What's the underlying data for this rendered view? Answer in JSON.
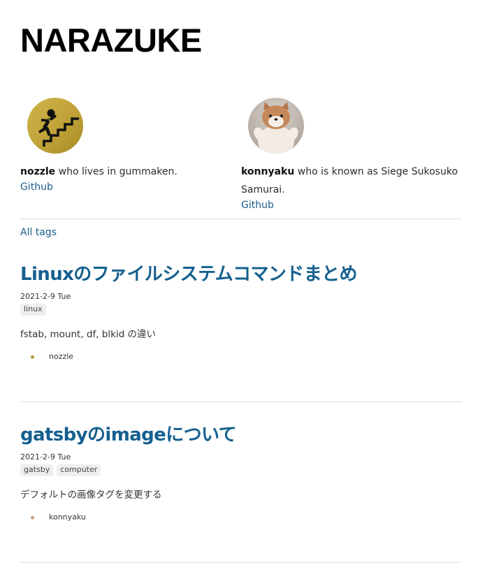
{
  "site": {
    "title": "NARAZUKE"
  },
  "authors": [
    {
      "name": "nozzle",
      "description": " who lives in gummaken.",
      "link_label": "Github",
      "avatar_icon": "falling-on-stairs-icon",
      "accent": "#b59b30"
    },
    {
      "name": "konnyaku",
      "description": " who is known as Siege Sukosuko Samurai.",
      "link_label": "Github",
      "avatar_icon": "shiba-plush-photo",
      "accent": "#c8a37e"
    }
  ],
  "nav": {
    "all_tags_label": "All tags"
  },
  "posts": [
    {
      "title": "Linuxのファイルシステムコマンドまとめ",
      "date": "2021-2-9 Tue",
      "tags": [
        "linux"
      ],
      "excerpt": "fstab, mount, df, blkid の違い",
      "author": "nozzle",
      "bullet_color": "#b59b30"
    },
    {
      "title": "gatsbyのimageについて",
      "date": "2021-2-9 Tue",
      "tags": [
        "gatsby",
        "computer"
      ],
      "excerpt": "デフォルトの画像タグを変更する",
      "author": "konnyaku",
      "bullet_color": "#c8a37e"
    }
  ],
  "colors": {
    "link": "#1a5f8a",
    "post_title": "#15608f",
    "tag_bg": "#eeeeee",
    "divider": "#dcdcdc"
  }
}
